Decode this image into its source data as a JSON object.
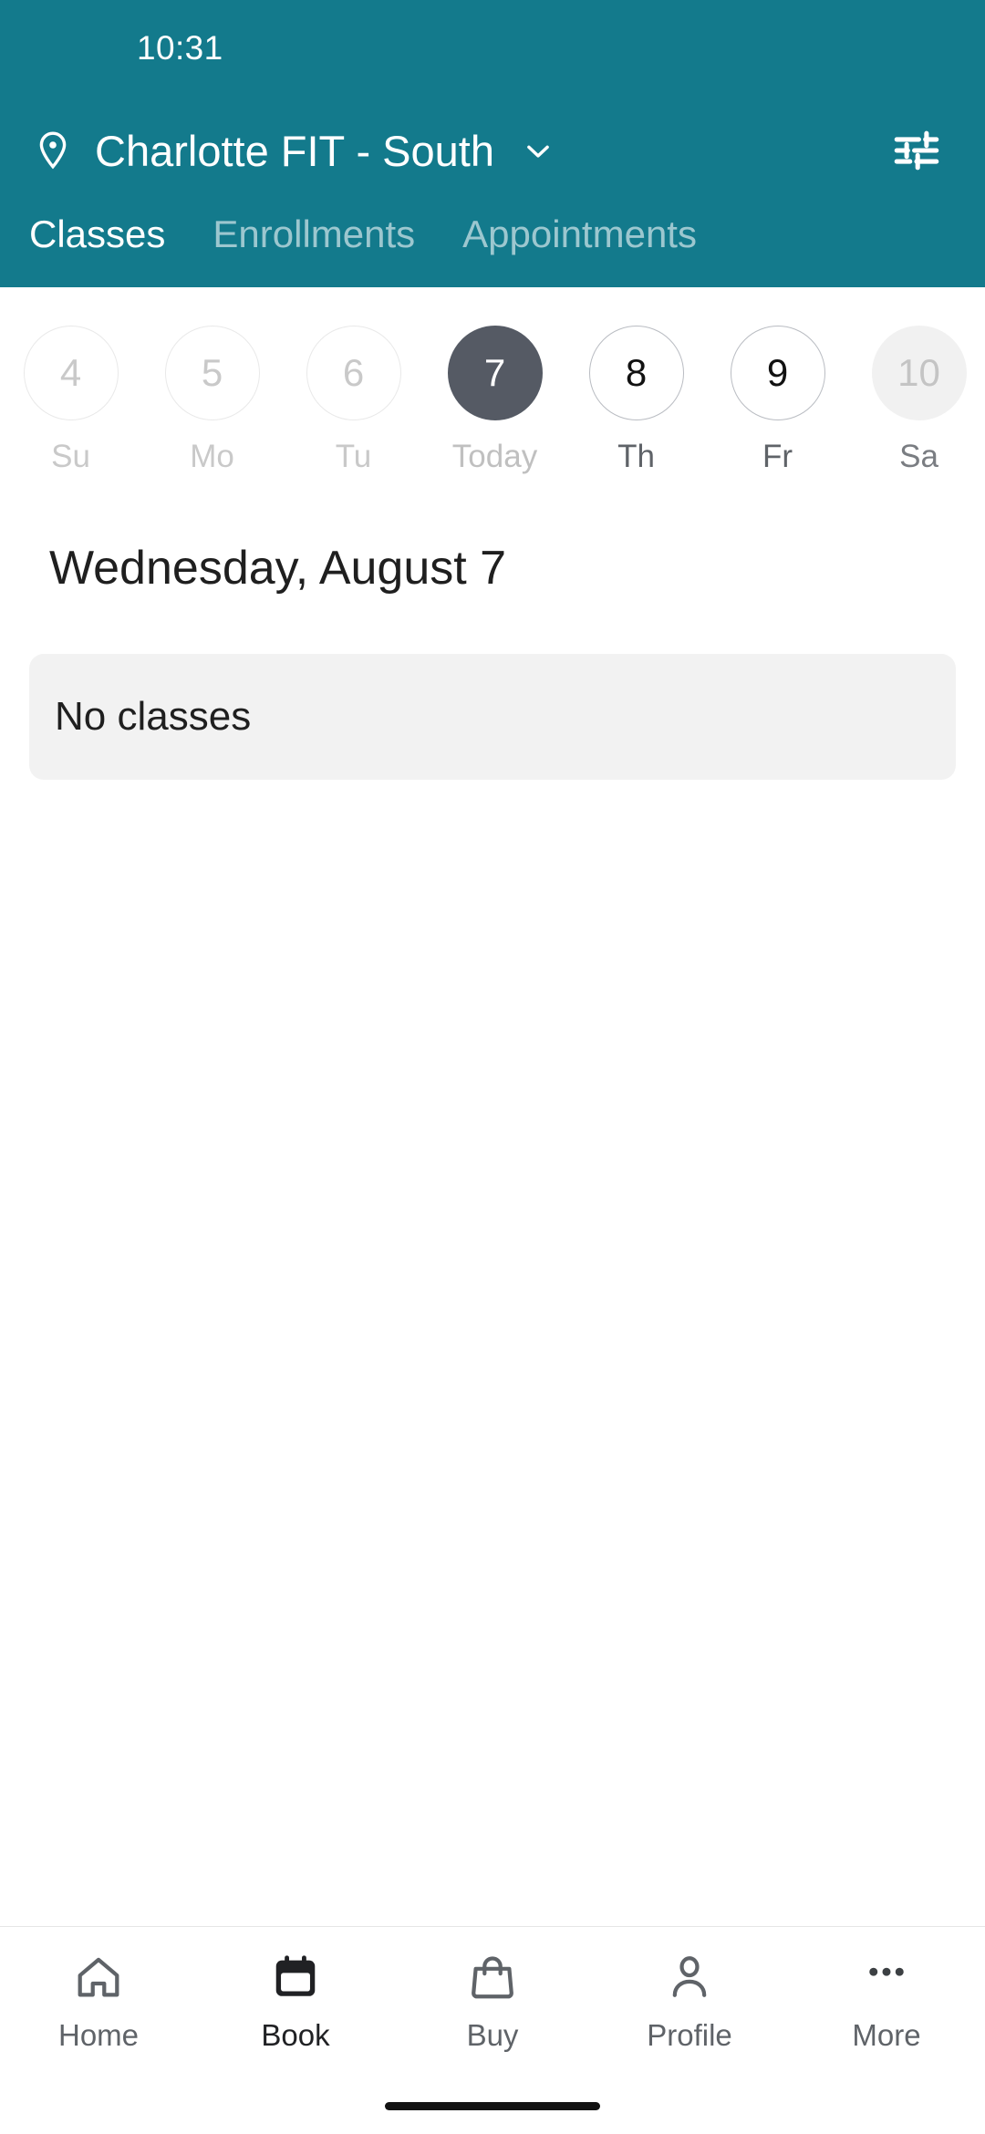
{
  "status_bar": {
    "time": "10:31"
  },
  "header": {
    "location_pin_icon": "location-pin-icon",
    "location_name": "Charlotte FIT - South",
    "location_chevron_icon": "chevron-down-icon",
    "filter_icon": "filter-sliders-icon",
    "brand_color": "#137A8C"
  },
  "tabs": [
    {
      "label": "Classes",
      "active": true
    },
    {
      "label": "Enrollments",
      "active": false
    },
    {
      "label": "Appointments",
      "active": false
    }
  ],
  "date_strip": {
    "selected_color": "#555A64",
    "days": [
      {
        "day": "4",
        "dow": "Su",
        "state": "past"
      },
      {
        "day": "5",
        "dow": "Mo",
        "state": "past"
      },
      {
        "day": "6",
        "dow": "Tu",
        "state": "past"
      },
      {
        "day": "7",
        "dow": "Today",
        "state": "selected"
      },
      {
        "day": "8",
        "dow": "Th",
        "state": "available"
      },
      {
        "day": "9",
        "dow": "Fr",
        "state": "available"
      },
      {
        "day": "10",
        "dow": "Sa",
        "state": "closed"
      }
    ]
  },
  "main": {
    "day_heading": "Wednesday, August 7",
    "empty_state": "No classes"
  },
  "bottom_nav": [
    {
      "label": "Home",
      "icon": "home-icon",
      "active": false
    },
    {
      "label": "Book",
      "icon": "calendar-icon",
      "active": true
    },
    {
      "label": "Buy",
      "icon": "shopping-bag-icon",
      "active": false
    },
    {
      "label": "Profile",
      "icon": "person-icon",
      "active": false
    },
    {
      "label": "More",
      "icon": "more-dots-icon",
      "active": false
    }
  ]
}
